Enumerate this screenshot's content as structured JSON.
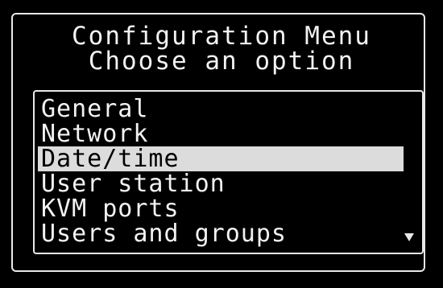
{
  "header": {
    "title": "Configuration Menu",
    "subtitle": "Choose an option"
  },
  "menu": {
    "items": [
      {
        "label": "General",
        "selected": false
      },
      {
        "label": "Network",
        "selected": false
      },
      {
        "label": "Date/time",
        "selected": true
      },
      {
        "label": "User station",
        "selected": false
      },
      {
        "label": "KVM ports",
        "selected": false
      },
      {
        "label": "Users and groups",
        "selected": false
      }
    ],
    "scroll_indicator_icon": "triangle-down"
  },
  "colors": {
    "background": "#000000",
    "text": "#f2f2f2",
    "highlight_bg": "#dcdcdc",
    "highlight_text": "#000000"
  }
}
